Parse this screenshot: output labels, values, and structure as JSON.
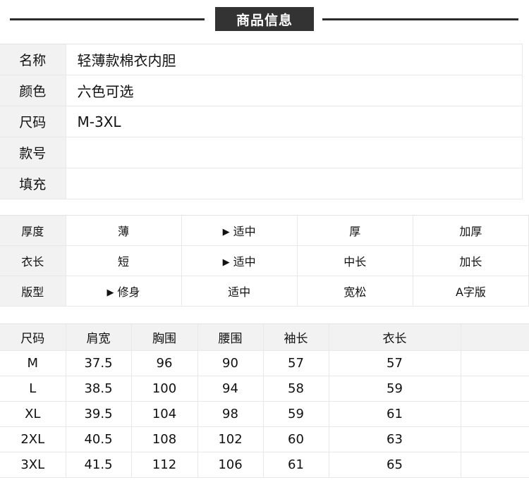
{
  "banner": {
    "title": "商品信息",
    "box_color": "#333333",
    "rule_color": "#2b2b2b"
  },
  "spec_table": {
    "rows": [
      {
        "label": "名称",
        "value": "轻薄款棉衣内胆"
      },
      {
        "label": "颜色",
        "value": "六色可选"
      },
      {
        "label": "尺码",
        "value": "M-3XL"
      },
      {
        "label": "款号",
        "value": ""
      },
      {
        "label": "填充",
        "value": ""
      }
    ]
  },
  "attr_table": {
    "marker": "▶",
    "rows": [
      {
        "label": "厚度",
        "options": [
          {
            "text": "薄",
            "selected": false
          },
          {
            "text": "适中",
            "selected": true
          },
          {
            "text": "厚",
            "selected": false
          },
          {
            "text": "加厚",
            "selected": false
          }
        ]
      },
      {
        "label": "衣长",
        "options": [
          {
            "text": "短",
            "selected": false
          },
          {
            "text": "适中",
            "selected": true
          },
          {
            "text": "中长",
            "selected": false
          },
          {
            "text": "加长",
            "selected": false
          }
        ]
      },
      {
        "label": "版型",
        "options": [
          {
            "text": "修身",
            "selected": true
          },
          {
            "text": "适中",
            "selected": false
          },
          {
            "text": "宽松",
            "selected": false
          },
          {
            "text": "A字版",
            "selected": false
          }
        ]
      }
    ]
  },
  "size_table": {
    "headers": [
      "尺码",
      "肩宽",
      "胸围",
      "腰围",
      "袖长",
      "衣长",
      ""
    ],
    "rows": [
      [
        "M",
        "37.5",
        "96",
        "90",
        "57",
        "57",
        ""
      ],
      [
        "L",
        "38.5",
        "100",
        "94",
        "58",
        "59",
        ""
      ],
      [
        "XL",
        "39.5",
        "104",
        "98",
        "59",
        "61",
        ""
      ],
      [
        "2XL",
        "40.5",
        "108",
        "102",
        "60",
        "63",
        ""
      ],
      [
        "3XL",
        "41.5",
        "112",
        "106",
        "61",
        "65",
        ""
      ]
    ]
  }
}
